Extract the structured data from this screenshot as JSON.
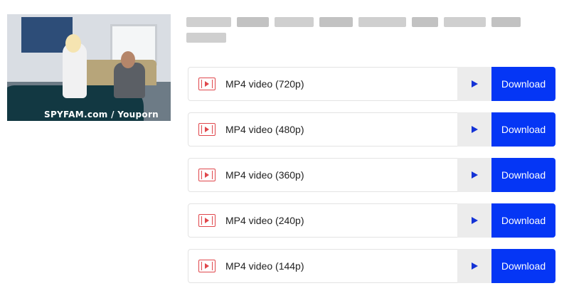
{
  "thumbnail": {
    "watermark": "SPYFAM.com / Youporn"
  },
  "colors": {
    "accent": "#0536f5",
    "play_accent": "#1433d6",
    "icon_red": "#e0474c",
    "border": "#e3e3e3"
  },
  "icons": {
    "format": "film-play-icon",
    "preview": "play-icon"
  },
  "formats": [
    {
      "label": "MP4 video (720p)",
      "download_label": "Download"
    },
    {
      "label": "MP4 video (480p)",
      "download_label": "Download"
    },
    {
      "label": "MP4 video (360p)",
      "download_label": "Download"
    },
    {
      "label": "MP4 video (240p)",
      "download_label": "Download"
    },
    {
      "label": "MP4 video (144p)",
      "download_label": "Download"
    }
  ]
}
